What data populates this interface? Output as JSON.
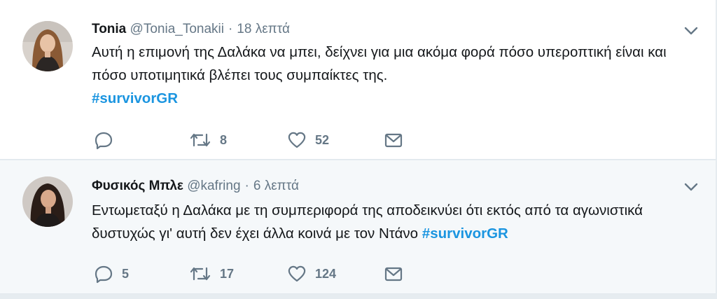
{
  "tweets": [
    {
      "fullname": "Tonia",
      "screenname": "@Tonia_Tonakii",
      "time": "18 λεπτά",
      "text": "Αυτή η επιμονή της Δαλάκα να μπει, δείχνει για μια ακόμα φορά πόσο υπεροπτική είναι και πόσο υποτιμητικά βλέπει τους συμπαίκτες της.",
      "hashtag": "#survivorGR",
      "replies": "",
      "retweets": "8",
      "likes": "52"
    },
    {
      "fullname": "Φυσικός Μπλε",
      "screenname": "@kafring",
      "time": "6 λεπτά",
      "text": "Εντωμεταξύ η Δαλάκα με τη συμπεριφορά της αποδεικνύει ότι εκτός από τα αγωνιστικά δυστυχώς γι' αυτή δεν έχει άλλα κοινά με τον Ντάνο",
      "hashtag": "#survivorGR",
      "replies": "5",
      "retweets": "17",
      "likes": "124"
    }
  ],
  "colors": {
    "text": "#14171a",
    "secondary": "#657786",
    "hashtag": "#1b95e0",
    "background": "#e6ecf0",
    "alt_row": "#f5f8fa"
  },
  "icons": {
    "reply": "reply-icon",
    "retweet": "retweet-icon",
    "like": "heart-icon",
    "dm": "envelope-icon",
    "caret": "chevron-down-icon"
  }
}
